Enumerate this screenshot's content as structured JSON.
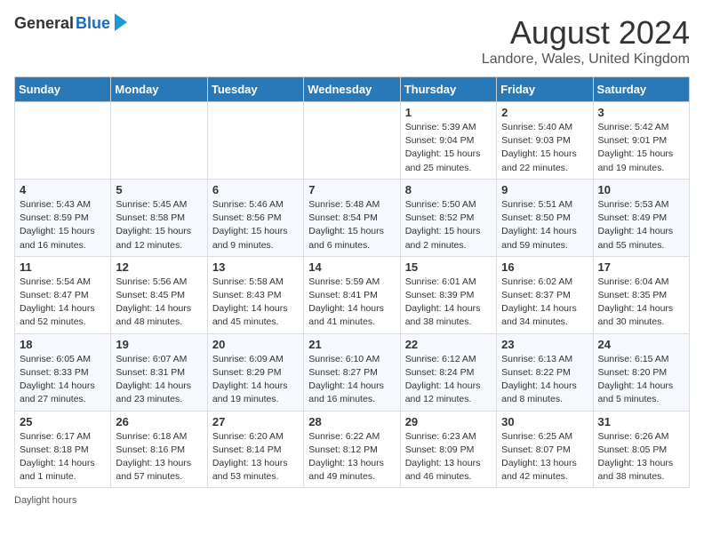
{
  "header": {
    "logo_general": "General",
    "logo_blue": "Blue",
    "title": "August 2024",
    "subtitle": "Landore, Wales, United Kingdom"
  },
  "calendar": {
    "days_of_week": [
      "Sunday",
      "Monday",
      "Tuesday",
      "Wednesday",
      "Thursday",
      "Friday",
      "Saturday"
    ],
    "weeks": [
      [
        {
          "day": "",
          "info": ""
        },
        {
          "day": "",
          "info": ""
        },
        {
          "day": "",
          "info": ""
        },
        {
          "day": "",
          "info": ""
        },
        {
          "day": "1",
          "info": "Sunrise: 5:39 AM\nSunset: 9:04 PM\nDaylight: 15 hours\nand 25 minutes."
        },
        {
          "day": "2",
          "info": "Sunrise: 5:40 AM\nSunset: 9:03 PM\nDaylight: 15 hours\nand 22 minutes."
        },
        {
          "day": "3",
          "info": "Sunrise: 5:42 AM\nSunset: 9:01 PM\nDaylight: 15 hours\nand 19 minutes."
        }
      ],
      [
        {
          "day": "4",
          "info": "Sunrise: 5:43 AM\nSunset: 8:59 PM\nDaylight: 15 hours\nand 16 minutes."
        },
        {
          "day": "5",
          "info": "Sunrise: 5:45 AM\nSunset: 8:58 PM\nDaylight: 15 hours\nand 12 minutes."
        },
        {
          "day": "6",
          "info": "Sunrise: 5:46 AM\nSunset: 8:56 PM\nDaylight: 15 hours\nand 9 minutes."
        },
        {
          "day": "7",
          "info": "Sunrise: 5:48 AM\nSunset: 8:54 PM\nDaylight: 15 hours\nand 6 minutes."
        },
        {
          "day": "8",
          "info": "Sunrise: 5:50 AM\nSunset: 8:52 PM\nDaylight: 15 hours\nand 2 minutes."
        },
        {
          "day": "9",
          "info": "Sunrise: 5:51 AM\nSunset: 8:50 PM\nDaylight: 14 hours\nand 59 minutes."
        },
        {
          "day": "10",
          "info": "Sunrise: 5:53 AM\nSunset: 8:49 PM\nDaylight: 14 hours\nand 55 minutes."
        }
      ],
      [
        {
          "day": "11",
          "info": "Sunrise: 5:54 AM\nSunset: 8:47 PM\nDaylight: 14 hours\nand 52 minutes."
        },
        {
          "day": "12",
          "info": "Sunrise: 5:56 AM\nSunset: 8:45 PM\nDaylight: 14 hours\nand 48 minutes."
        },
        {
          "day": "13",
          "info": "Sunrise: 5:58 AM\nSunset: 8:43 PM\nDaylight: 14 hours\nand 45 minutes."
        },
        {
          "day": "14",
          "info": "Sunrise: 5:59 AM\nSunset: 8:41 PM\nDaylight: 14 hours\nand 41 minutes."
        },
        {
          "day": "15",
          "info": "Sunrise: 6:01 AM\nSunset: 8:39 PM\nDaylight: 14 hours\nand 38 minutes."
        },
        {
          "day": "16",
          "info": "Sunrise: 6:02 AM\nSunset: 8:37 PM\nDaylight: 14 hours\nand 34 minutes."
        },
        {
          "day": "17",
          "info": "Sunrise: 6:04 AM\nSunset: 8:35 PM\nDaylight: 14 hours\nand 30 minutes."
        }
      ],
      [
        {
          "day": "18",
          "info": "Sunrise: 6:05 AM\nSunset: 8:33 PM\nDaylight: 14 hours\nand 27 minutes."
        },
        {
          "day": "19",
          "info": "Sunrise: 6:07 AM\nSunset: 8:31 PM\nDaylight: 14 hours\nand 23 minutes."
        },
        {
          "day": "20",
          "info": "Sunrise: 6:09 AM\nSunset: 8:29 PM\nDaylight: 14 hours\nand 19 minutes."
        },
        {
          "day": "21",
          "info": "Sunrise: 6:10 AM\nSunset: 8:27 PM\nDaylight: 14 hours\nand 16 minutes."
        },
        {
          "day": "22",
          "info": "Sunrise: 6:12 AM\nSunset: 8:24 PM\nDaylight: 14 hours\nand 12 minutes."
        },
        {
          "day": "23",
          "info": "Sunrise: 6:13 AM\nSunset: 8:22 PM\nDaylight: 14 hours\nand 8 minutes."
        },
        {
          "day": "24",
          "info": "Sunrise: 6:15 AM\nSunset: 8:20 PM\nDaylight: 14 hours\nand 5 minutes."
        }
      ],
      [
        {
          "day": "25",
          "info": "Sunrise: 6:17 AM\nSunset: 8:18 PM\nDaylight: 14 hours\nand 1 minute."
        },
        {
          "day": "26",
          "info": "Sunrise: 6:18 AM\nSunset: 8:16 PM\nDaylight: 13 hours\nand 57 minutes."
        },
        {
          "day": "27",
          "info": "Sunrise: 6:20 AM\nSunset: 8:14 PM\nDaylight: 13 hours\nand 53 minutes."
        },
        {
          "day": "28",
          "info": "Sunrise: 6:22 AM\nSunset: 8:12 PM\nDaylight: 13 hours\nand 49 minutes."
        },
        {
          "day": "29",
          "info": "Sunrise: 6:23 AM\nSunset: 8:09 PM\nDaylight: 13 hours\nand 46 minutes."
        },
        {
          "day": "30",
          "info": "Sunrise: 6:25 AM\nSunset: 8:07 PM\nDaylight: 13 hours\nand 42 minutes."
        },
        {
          "day": "31",
          "info": "Sunrise: 6:26 AM\nSunset: 8:05 PM\nDaylight: 13 hours\nand 38 minutes."
        }
      ]
    ]
  },
  "footer": {
    "note": "Daylight hours"
  }
}
